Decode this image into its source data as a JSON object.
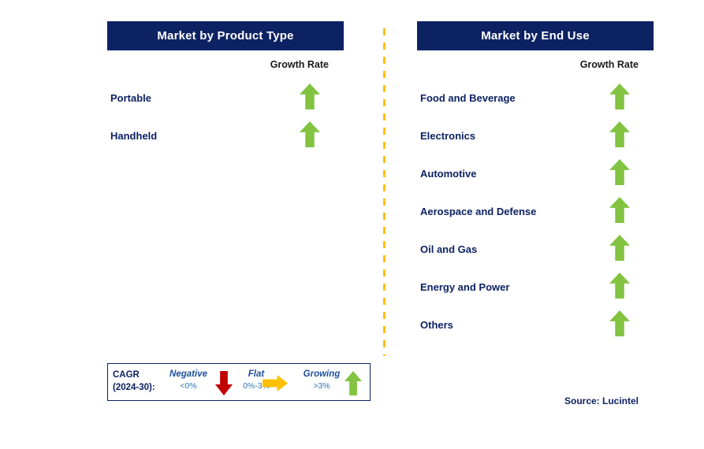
{
  "panels": [
    {
      "id": "product-type",
      "title": "Market by Product Type",
      "growth_rate_label": "Growth Rate",
      "rows": [
        {
          "label": "Portable",
          "trend": "growing",
          "icon": "arrow-up-icon"
        },
        {
          "label": "Handheld",
          "trend": "growing",
          "icon": "arrow-up-icon"
        }
      ]
    },
    {
      "id": "end-use",
      "title": "Market by End Use",
      "growth_rate_label": "Growth Rate",
      "rows": [
        {
          "label": "Food and Beverage",
          "trend": "growing",
          "icon": "arrow-up-icon"
        },
        {
          "label": "Electronics",
          "trend": "growing",
          "icon": "arrow-up-icon"
        },
        {
          "label": "Automotive",
          "trend": "growing",
          "icon": "arrow-up-icon"
        },
        {
          "label": "Aerospace and Defense",
          "trend": "growing",
          "icon": "arrow-up-icon"
        },
        {
          "label": "Oil and Gas",
          "trend": "growing",
          "icon": "arrow-up-icon"
        },
        {
          "label": "Energy and Power",
          "trend": "growing",
          "icon": "arrow-up-icon"
        },
        {
          "label": "Others",
          "trend": "growing",
          "icon": "arrow-up-icon"
        }
      ]
    }
  ],
  "legend": {
    "cagr_line1": "CAGR",
    "cagr_line2": "(2024-30):",
    "items": [
      {
        "title": "Negative",
        "range": "<0%",
        "icon": "arrow-down-icon",
        "color": "#c00000"
      },
      {
        "title": "Flat",
        "range": "0%-3%",
        "icon": "arrow-right-icon",
        "color": "#ffc000"
      },
      {
        "title": "Growing",
        "range": ">3%",
        "icon": "arrow-up-icon",
        "color": "#82c341"
      }
    ]
  },
  "source": "Source: Lucintel",
  "colors": {
    "header_navy": "#0d2262",
    "growth_green": "#82c341",
    "negative_red": "#c00000",
    "flat_yellow": "#ffc000",
    "divider_yellow": "#ffc000",
    "label_navy": "#0d2262",
    "range_blue": "#2e75b6"
  }
}
